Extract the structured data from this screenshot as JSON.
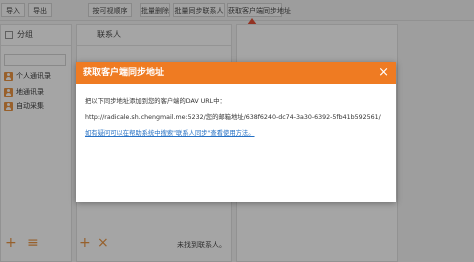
{
  "toolbar": {
    "buttons": [
      {
        "label": "导入"
      },
      {
        "label": "导出"
      },
      {
        "label": "按可视顺序"
      },
      {
        "label": "批量删除"
      },
      {
        "label": "批量同步联系人"
      },
      {
        "label": "获取客户端同步地址"
      }
    ]
  },
  "groups_panel": {
    "title": "分组",
    "items": [
      {
        "label": "个人通讯录"
      },
      {
        "label": "地通讯录"
      },
      {
        "label": "自动采集"
      }
    ]
  },
  "contacts_panel": {
    "title": "联系人",
    "empty_text": "未找到联系人。"
  },
  "dialog": {
    "title": "获取客户端同步地址",
    "close_glyph": "×",
    "intro": "把以下同步地址添加到您的客户端的DAV URL中：",
    "url": "http://radicale.sh.chengmail.me:5232/您的邮箱地址/638f6240-dc74-3a30-6392-5fb41b592561/",
    "help_link": "如有疑问可以在帮助系统中搜索\"联系人同步\"查看使用方法。"
  },
  "icons": {
    "add": "+",
    "menu": "≡",
    "close": "×"
  },
  "colors": {
    "accent": "#ef7b22",
    "arrow": "#e13c1f",
    "link": "#2570c4"
  }
}
